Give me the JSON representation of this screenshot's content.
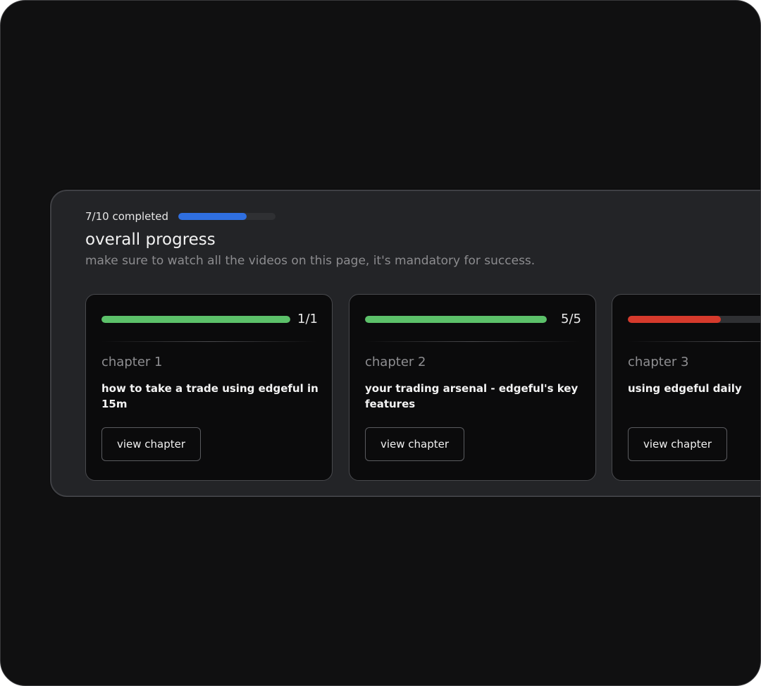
{
  "overall": {
    "completed_text": "7/10 completed",
    "progress": 0.7,
    "bar_color": "#2f6fe0",
    "title": "overall progress",
    "subtitle": "make sure to watch all the videos on this page, it's mandatory for success."
  },
  "chapters": [
    {
      "count": "1/1",
      "progress": 1.0,
      "bar_color": "#5cc16a",
      "label": "chapter 1",
      "title": "how to take a trade using edgeful in 15m",
      "button_label": "view chapter"
    },
    {
      "count": "5/5",
      "progress": 1.0,
      "bar_color": "#5cc16a",
      "label": "chapter 2",
      "title": "your trading arsenal - edgeful's key features",
      "button_label": "view chapter"
    },
    {
      "count": "",
      "progress": 0.5,
      "bar_color": "#d63a2c",
      "label": "chapter 3",
      "title": "using edgeful daily",
      "button_label": "view chapter"
    }
  ]
}
